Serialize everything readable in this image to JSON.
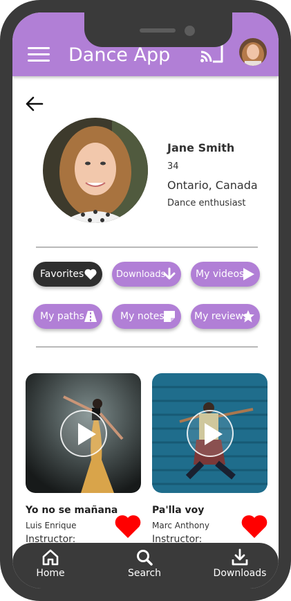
{
  "app": {
    "title": "Dance App"
  },
  "profile": {
    "name": "Jane Smith",
    "age": "34",
    "location": "Ontario, Canada",
    "bio": "Dance enthusiast"
  },
  "chips": [
    {
      "label": "Favorites",
      "icon": "heart-icon",
      "active": true
    },
    {
      "label": "Downloads",
      "icon": "download-arrow-icon",
      "active": false
    },
    {
      "label": "My videos",
      "icon": "play-triangle-icon",
      "active": false
    },
    {
      "label": "My paths",
      "icon": "road-icon",
      "active": false
    },
    {
      "label": "My notes",
      "icon": "sticky-note-icon",
      "active": false
    },
    {
      "label": "My reviews",
      "icon": "star-icon",
      "active": false
    }
  ],
  "videos": [
    {
      "title": "Yo no se mañana",
      "artist": "Luis Enrique",
      "instructor_label": "Instructor:",
      "favorited": true
    },
    {
      "title": "Pa'lla voy",
      "artist": "Marc Anthony",
      "instructor_label": "Instructor:",
      "favorited": true
    }
  ],
  "nav": [
    {
      "label": "Home",
      "icon": "home-icon"
    },
    {
      "label": "Search",
      "icon": "search-icon"
    },
    {
      "label": "Downloads",
      "icon": "download-icon"
    }
  ],
  "colors": {
    "accent": "#b17fd6",
    "dark": "#2f2f2f",
    "heart": "#ff0000",
    "frame": "#3a3a3a"
  }
}
